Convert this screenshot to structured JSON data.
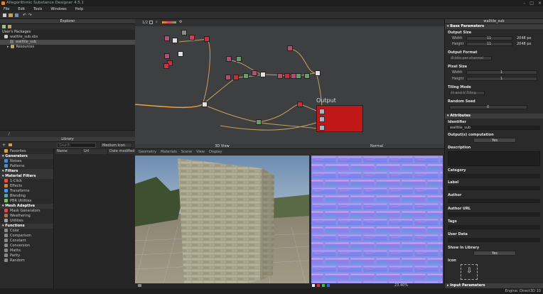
{
  "app": {
    "title": "Allegorithmic Substance Designer 4.5.1"
  },
  "menu": [
    "File",
    "Edit",
    "Tools",
    "Windows",
    "Help"
  ],
  "explorer": {
    "title": "Explorer",
    "section": "User's Packages",
    "items": [
      {
        "label": "walltile_sub.sbs"
      },
      {
        "label": "walltile_sub"
      },
      {
        "label": "Resources"
      }
    ],
    "path": "/"
  },
  "graph": {
    "output_label": "Output",
    "zoom": "1/2"
  },
  "library": {
    "title": "Library",
    "search_placeholder": "Search",
    "view": "Medium Icon",
    "columns": [
      "Name",
      "Url",
      "Date modified"
    ],
    "groups": [
      {
        "label": "Favorites",
        "type": "item",
        "color": "#d4a050"
      },
      {
        "label": "Generators",
        "type": "cat"
      },
      {
        "label": "Noises",
        "type": "item",
        "color": "#4a8ad0"
      },
      {
        "label": "Patterns",
        "type": "item",
        "color": "#4a8ad0"
      },
      {
        "label": "Filters",
        "type": "cat"
      },
      {
        "label": "Material Filters",
        "type": "cat"
      },
      {
        "label": "1-Click",
        "type": "item",
        "color": "#e05050"
      },
      {
        "label": "Effects",
        "type": "item",
        "color": "#d08040"
      },
      {
        "label": "Transforms",
        "type": "item",
        "color": "#5090e0"
      },
      {
        "label": "Blending",
        "type": "item",
        "color": "#50a0c0"
      },
      {
        "label": "PBR Utilities",
        "type": "item",
        "color": "#80c060"
      },
      {
        "label": "Mesh Adaptive",
        "type": "cat"
      },
      {
        "label": "Mask Generators",
        "type": "item",
        "color": "#d05050"
      },
      {
        "label": "Weathering",
        "type": "item",
        "color": "#b07050"
      },
      {
        "label": "Utilities",
        "type": "item",
        "color": "#a0a0a0"
      },
      {
        "label": "Functions",
        "type": "cat"
      },
      {
        "label": "Color",
        "type": "item",
        "color": "#888"
      },
      {
        "label": "Comparison",
        "type": "item",
        "color": "#888"
      },
      {
        "label": "Constant",
        "type": "item",
        "color": "#888"
      },
      {
        "label": "Conversion",
        "type": "item",
        "color": "#888"
      },
      {
        "label": "Maths",
        "type": "item",
        "color": "#888"
      },
      {
        "label": "Parity",
        "type": "item",
        "color": "#888"
      },
      {
        "label": "Random",
        "type": "item",
        "color": "#888"
      }
    ]
  },
  "view3d": {
    "title": "3D View",
    "menu": [
      "Geometry",
      "Materials",
      "Scene",
      "View",
      "Display"
    ]
  },
  "view2d": {
    "title": "Normal",
    "zoom": "23.40%"
  },
  "props": {
    "title": "walltile_sub",
    "base_header": "Base Parameters",
    "output_size": "Output Size",
    "width_label": "Width",
    "width_val": "11",
    "width_px": "2048 px",
    "height_label": "Height",
    "height_val": "11",
    "height_px": "2048 px",
    "output_format": "Output Format",
    "format_val": "8 bits per channel",
    "pixel_size": "Pixel Size",
    "pw_label": "Width",
    "pw_val": "1",
    "ph_label": "Height",
    "ph_val": "1",
    "tiling": "Tiling Mode",
    "tiling_val": "H and V Tiling",
    "seed": "Random Seed",
    "seed_val": "0",
    "attr_header": "Attributes",
    "identifier": "Identifier",
    "identifier_val": "walltile_sub",
    "outputs_comp": "Output(s) computation",
    "yes1": "Yes",
    "description": "Description",
    "category": "Category",
    "label": "Label",
    "author": "Author",
    "author_url": "Author URL",
    "tags": "Tags",
    "user_data": "User Data",
    "show_lib": "Show In Library",
    "yes2": "Yes",
    "icon": "Icon",
    "input_header": "Input Parameters"
  },
  "status": {
    "engine": "Engine: Direct3D 10"
  }
}
